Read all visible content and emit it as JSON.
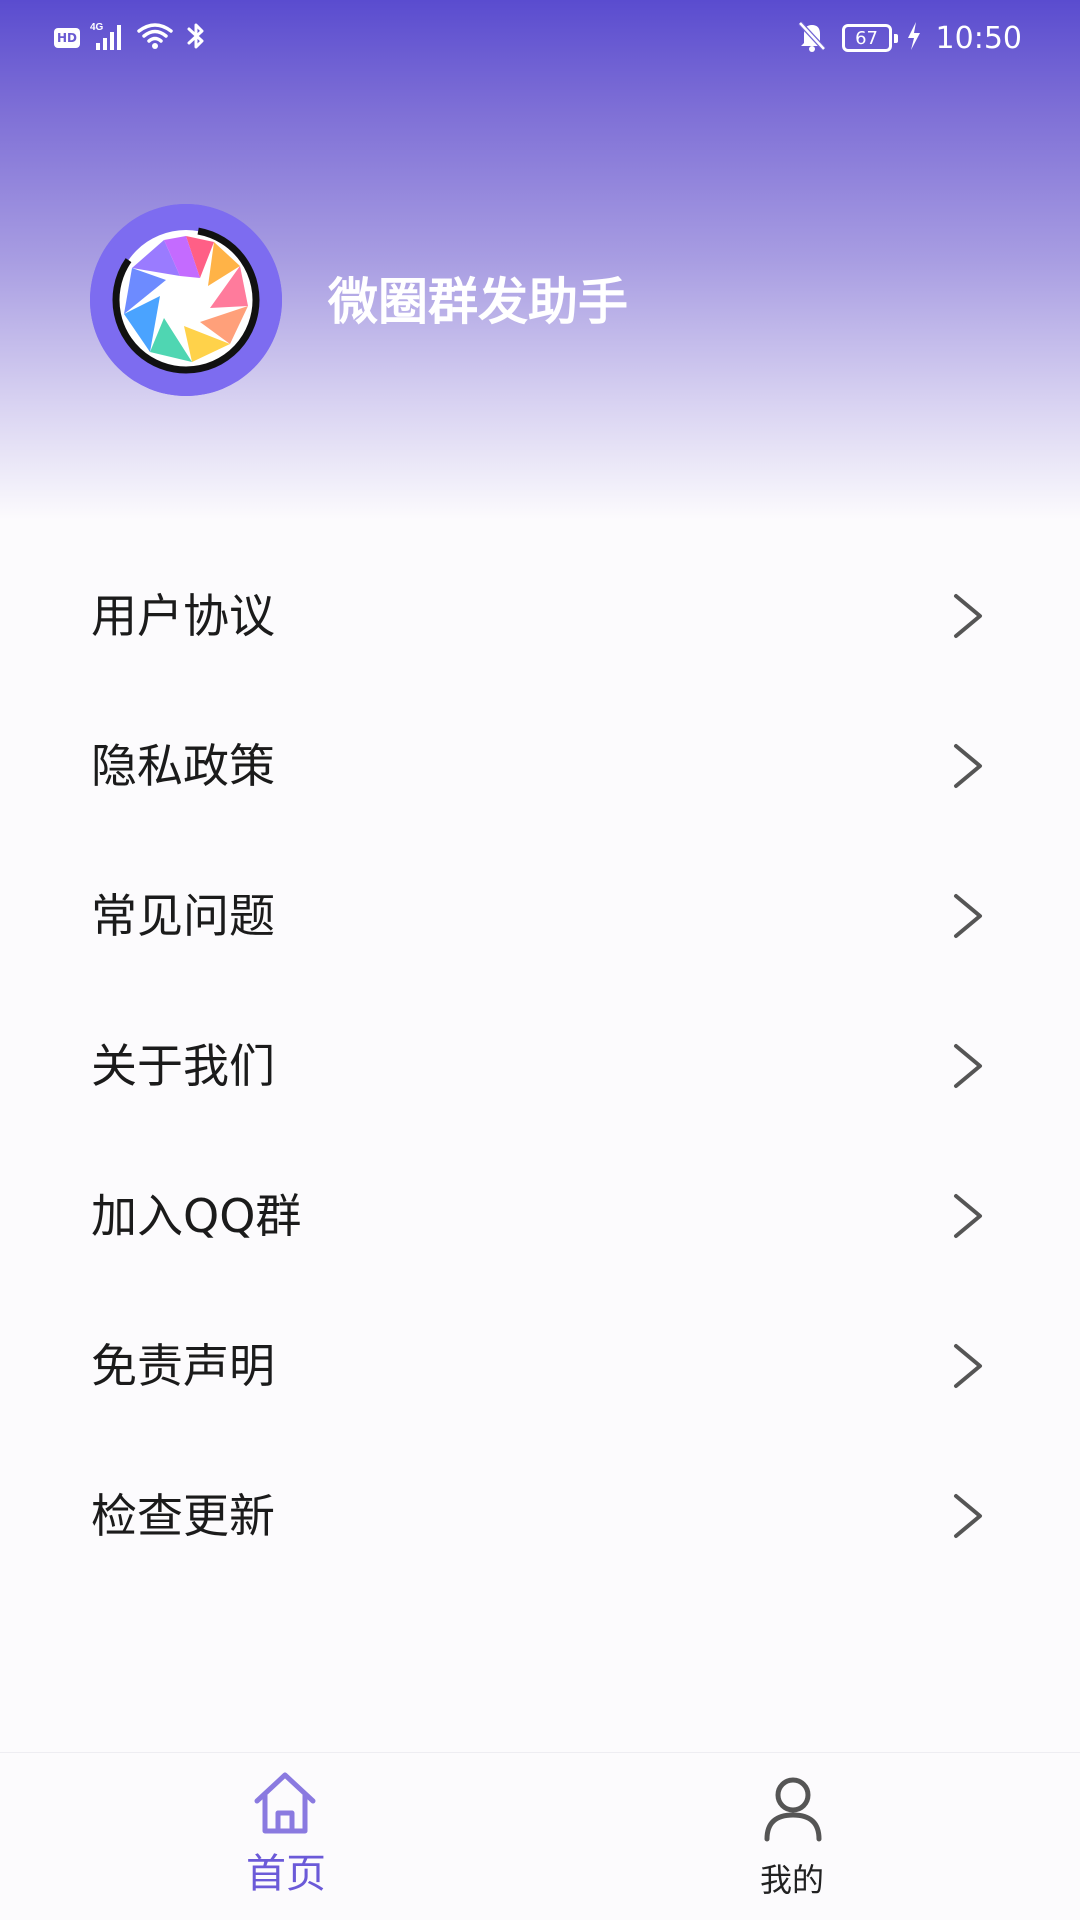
{
  "status_bar": {
    "hd": "HD",
    "network": "4G",
    "battery_level": "67",
    "time": "10:50",
    "icons": [
      "hd-icon",
      "signal-icon",
      "wifi-icon",
      "bluetooth-icon",
      "mute-bell-icon",
      "battery-icon",
      "charging-icon"
    ]
  },
  "header": {
    "app_name": "微圈群发助手",
    "logo_icon": "camera-shutter-logo"
  },
  "menu": {
    "items": [
      {
        "label": "用户协议",
        "icon": "chevron-right-icon"
      },
      {
        "label": "隐私政策",
        "icon": "chevron-right-icon"
      },
      {
        "label": "常见问题",
        "icon": "chevron-right-icon"
      },
      {
        "label": "关于我们",
        "icon": "chevron-right-icon"
      },
      {
        "label": "加入QQ群",
        "icon": "chevron-right-icon"
      },
      {
        "label": "免责声明",
        "icon": "chevron-right-icon"
      },
      {
        "label": "检查更新",
        "icon": "chevron-right-icon"
      }
    ]
  },
  "tab_bar": {
    "tabs": [
      {
        "label": "首页",
        "icon": "home-icon",
        "active": true
      },
      {
        "label": "我的",
        "icon": "user-icon",
        "active": false
      }
    ]
  },
  "colors": {
    "accent": "#6b5ad8",
    "header_top": "#5a4ccf",
    "background": "#fcfbfd",
    "logo_bg": "#7d6cf0"
  }
}
